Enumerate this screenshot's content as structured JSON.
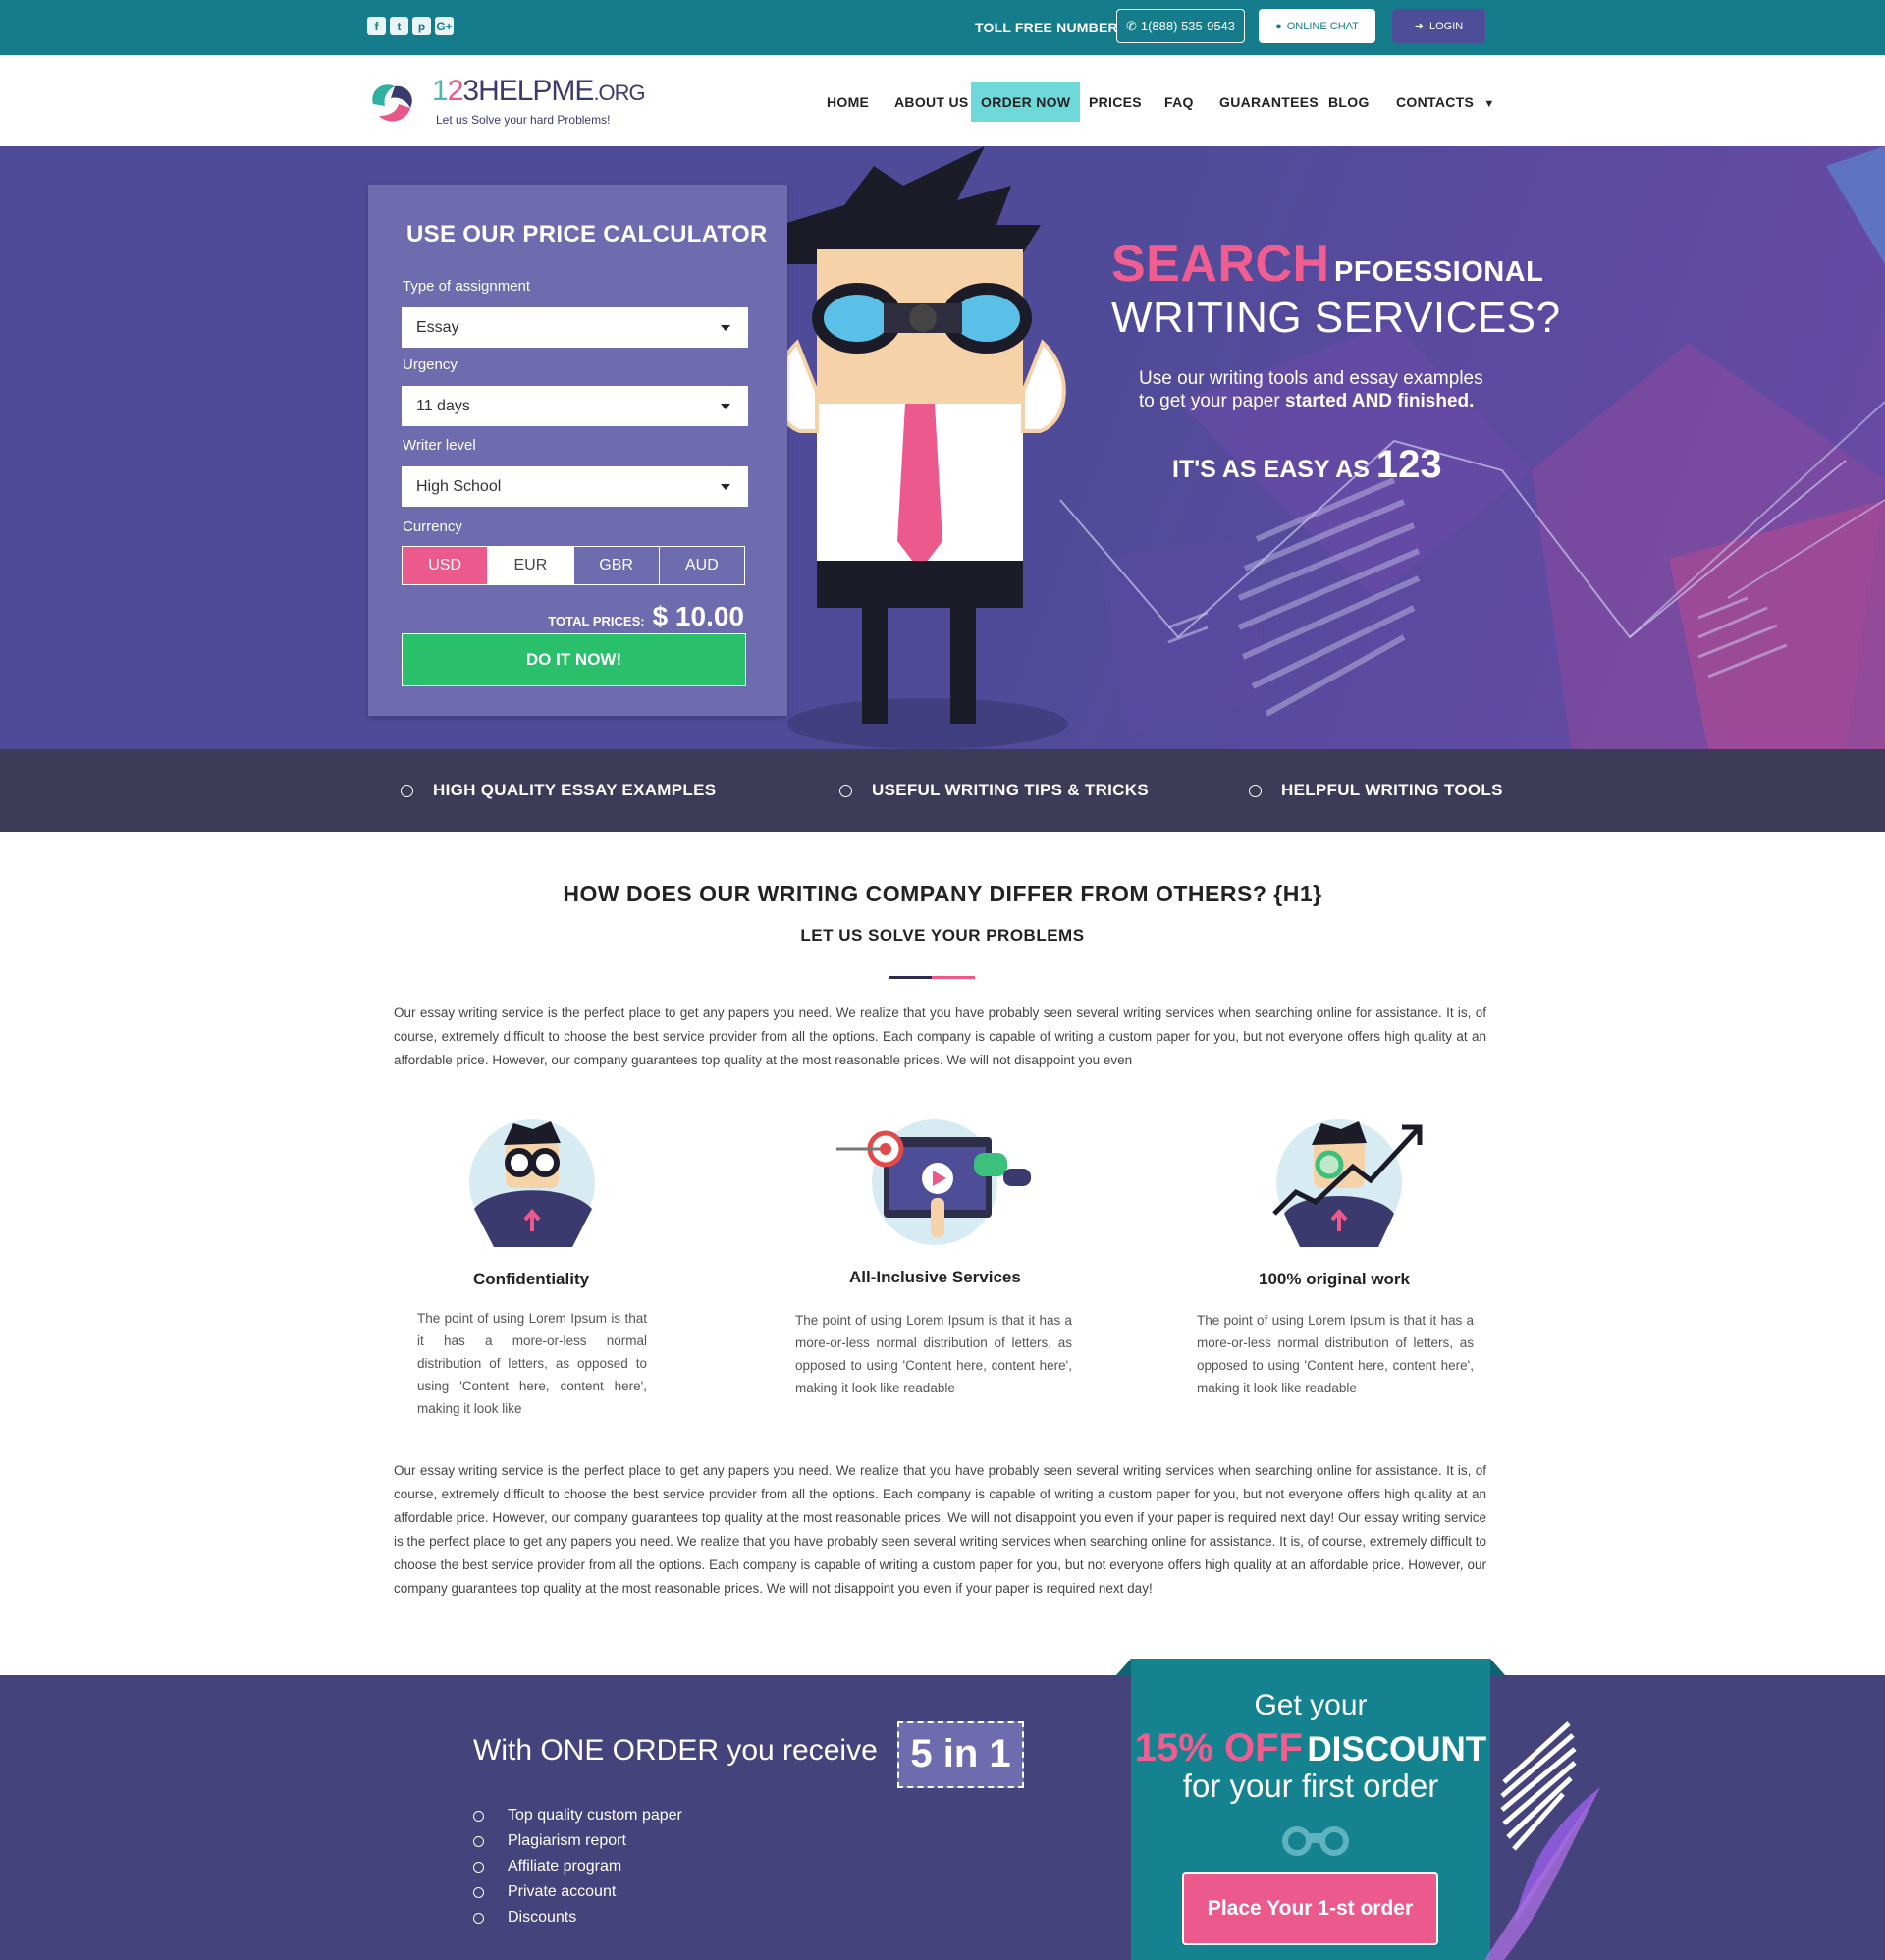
{
  "topbar": {
    "social": [
      {
        "icon": "facebook-icon",
        "glyph": "f"
      },
      {
        "icon": "twitter-icon",
        "glyph": "t"
      },
      {
        "icon": "pinterest-icon",
        "glyph": "p"
      },
      {
        "icon": "google-plus-icon",
        "glyph": "G+"
      }
    ],
    "toll_free_label": "TOLL FREE NUMBER",
    "phone": "1(888) 535-9543",
    "chat_label": "ONLINE CHAT",
    "login_label": "LOGIN"
  },
  "brand": {
    "logo_num1": "1",
    "logo_num2": "2",
    "logo_num3": "3",
    "logo_name": "HELPME",
    "logo_tld": ".ORG",
    "tagline": "Let us Solve your hard Problems!"
  },
  "nav": {
    "items": [
      "HOME",
      "ABOUT US",
      "ORDER NOW",
      "PRICES",
      "FAQ",
      "GUARANTEES",
      "BLOG",
      "CONTACTS"
    ],
    "active": "ORDER NOW"
  },
  "calculator": {
    "title": "USE OUR PRICE CALCULATOR",
    "assignment_label": "Type of assignment",
    "assignment_value": "Essay",
    "urgency_label": "Urgency",
    "urgency_value": "11 days",
    "level_label": "Writer level",
    "level_value": "High School",
    "currency_label": "Currency",
    "currencies": [
      "USD",
      "EUR",
      "GBR",
      "AUD"
    ],
    "selected_currency": "USD",
    "total_label": "TOTAL PRICES:",
    "total_value": "$ 10.00",
    "cta": "DO IT NOW!"
  },
  "hero": {
    "search": "SEARCH",
    "pfoessional": "PFOESSIONAL",
    "writing": "WRITING SERVICES?",
    "sub1": "Use our writing tools and essay examples",
    "sub2_prefix": "to get your paper ",
    "sub2_bold": "started AND finished.",
    "easy": "IT'S AS EASY AS",
    "easy_num": "123"
  },
  "strip": [
    "HIGH QUALITY ESSAY EXAMPLES",
    "USEFUL WRITING TIPS & TRICKS",
    "HELPFUL WRITING TOOLS"
  ],
  "content": {
    "h1": "HOW DOES OUR WRITING COMPANY DIFFER FROM OTHERS? {H1}",
    "h2": "LET US SOLVE YOUR PROBLEMS",
    "intro": "Our essay writing service is the perfect place to get any papers you need. We realize that you have probably seen several writing services when searching online for assistance. It is, of course, extremely difficult to choose the best service provider from all the options. Each company is capable of writing a custom paper for you, but not everyone offers high quality at an affordable price. However, our company guarantees top quality at the most reasonable prices. We will not disappoint you even",
    "features": [
      {
        "title": "Confidentiality",
        "text": "The point of using Lorem Ipsum is that it has a more-or-less normal distribution of letters, as opposed to using 'Content here, content here', making it look like"
      },
      {
        "title": "All-Inclusive Services",
        "text": "The point of using Lorem Ipsum is that it has a more-or-less normal distribution of letters, as opposed to using 'Content here, content here', making it look like readable"
      },
      {
        "title": "100% original work",
        "text": "The point of using Lorem Ipsum is that it has a more-or-less normal distribution of letters, as opposed to using 'Content here, content here', making it look like readable"
      }
    ],
    "body": "Our essay writing service is the perfect place to get any papers you need. We realize that you have probably seen several writing services when searching online for assistance. It is, of course, extremely difficult to choose the best service provider from all the options. Each company is capable of writing a custom paper for you, but not everyone offers high quality at an affordable price. However, our company guarantees top quality at the most reasonable prices. We will not disappoint you even if your paper is required next day!    Our essay writing service is the perfect place to get any papers you need. We realize that you have probably seen several writing services when searching online for assistance. It is, of course, extremely difficult to choose the best service provider from all the options. Each company is capable of writing a custom paper for you, but not everyone offers high quality at an affordable price. However, our company guarantees top quality at the most reasonable prices. We will not disappoint you even if your paper is required next day!"
  },
  "bottom": {
    "receive": "With ONE ORDER you receive",
    "badge": "5 in 1",
    "list": [
      "Top quality custom paper",
      "Plagiarism report",
      "Affiliate program",
      "Private account",
      "Discounts"
    ],
    "promo_get": "Get your",
    "promo_pct": "15% OFF",
    "promo_discount": "DISCOUNT",
    "promo_first": "for your first order",
    "promo_btn": "Place Your 1-st order"
  },
  "colors": {
    "topbar": "#147c8a",
    "hero": "#4f4b98",
    "accent_pink": "#ec5a8d",
    "cta_green": "#29bf6b",
    "nav_active": "#6fd9d9",
    "strip": "#3d3b57",
    "bottom": "#45437b"
  }
}
